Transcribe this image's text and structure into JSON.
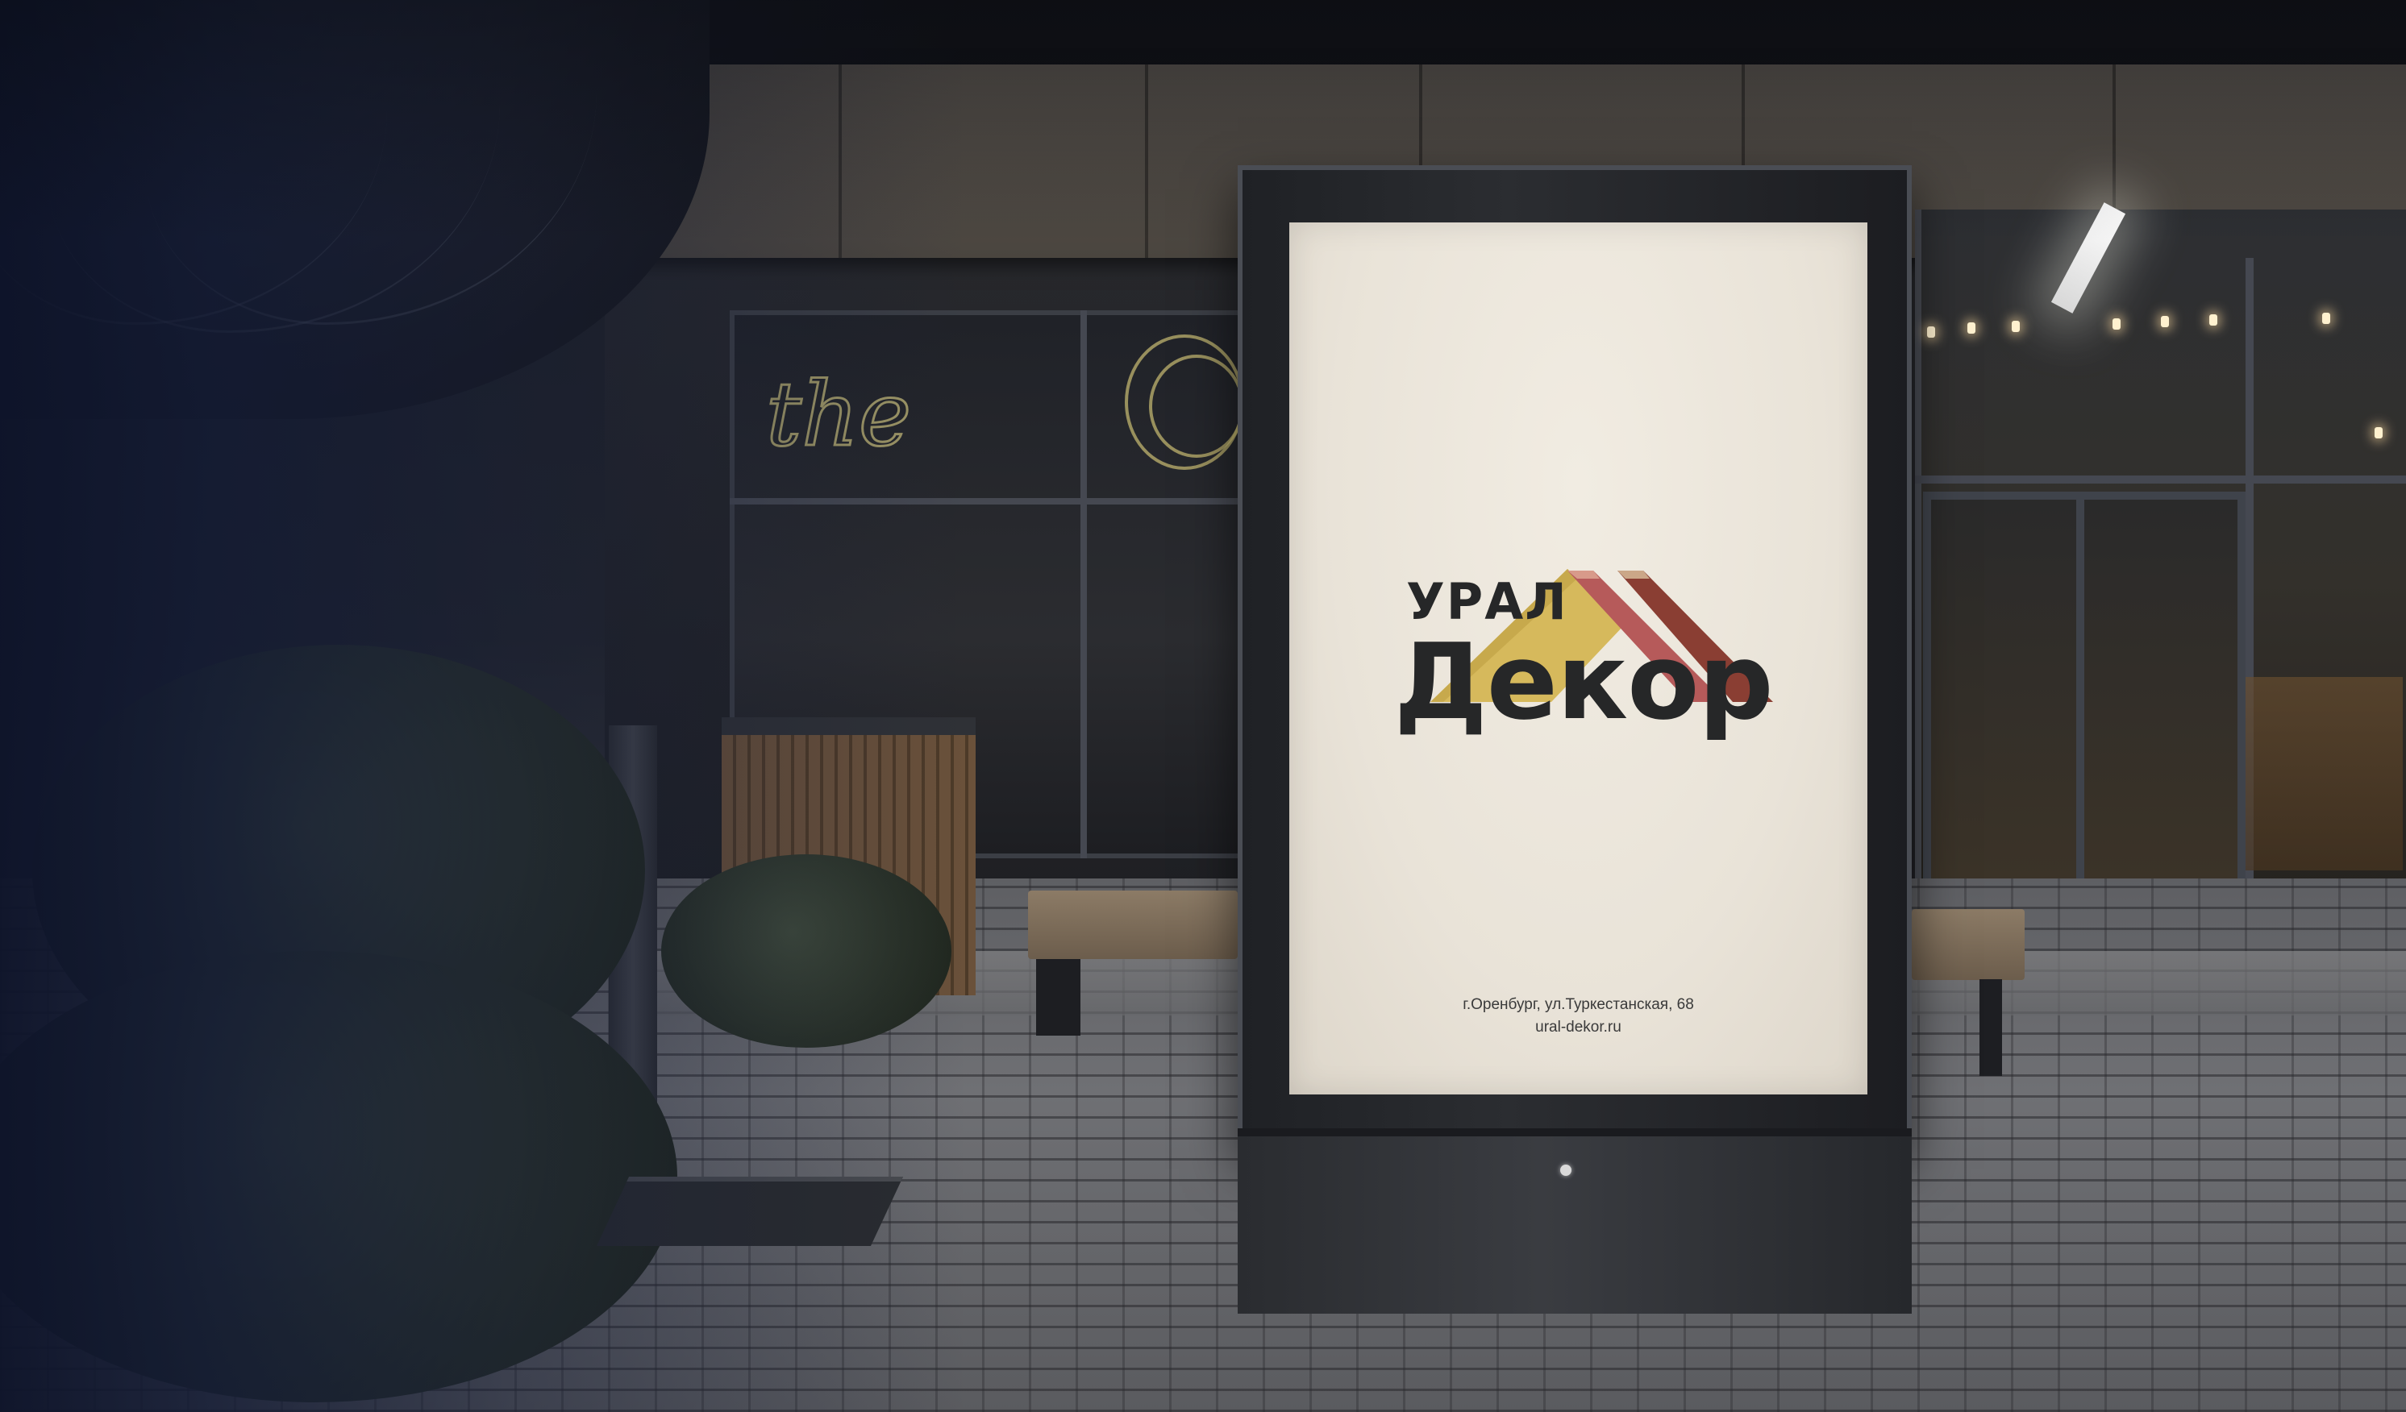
{
  "poster": {
    "brand_line1": "УРАЛ",
    "brand_line2": "Декор",
    "address": "г.Оренбург, ул.Туркестанская, 68",
    "website": "ural-dekor.ru"
  },
  "background": {
    "neon_sign": "the"
  },
  "colors": {
    "logo_gold": "#d6b95c",
    "logo_rose": "#b65a5a",
    "logo_maroon": "#8a3e33",
    "logo_text": "#262728",
    "vignette_blue": "#121a36"
  }
}
